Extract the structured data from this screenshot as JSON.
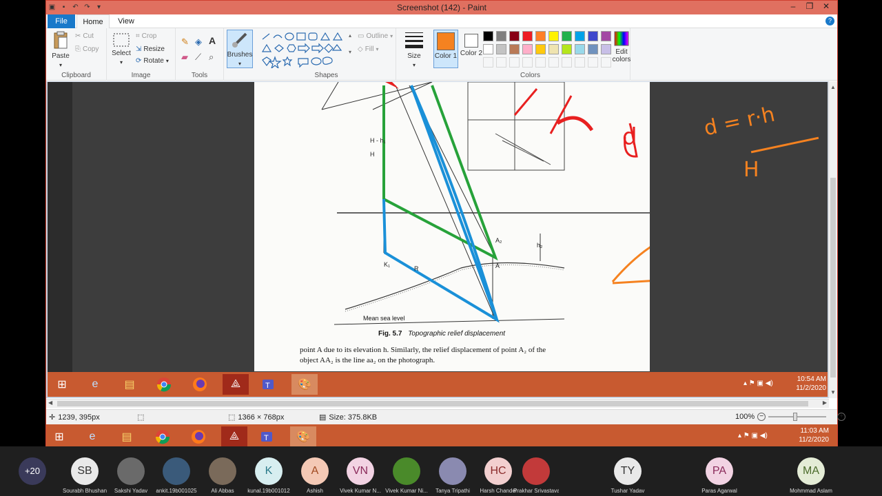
{
  "window": {
    "title": "Screenshot (142) - Paint"
  },
  "tabs": {
    "file": "File",
    "home": "Home",
    "view": "View"
  },
  "clipboard": {
    "paste": "Paste",
    "cut": "Cut",
    "copy": "Copy",
    "label": "Clipboard"
  },
  "image": {
    "select": "Select",
    "crop": "Crop",
    "resize": "Resize",
    "rotate": "Rotate",
    "label": "Image"
  },
  "tools": {
    "label": "Tools"
  },
  "brushes": {
    "label": "Brushes"
  },
  "shapes": {
    "outline": "Outline",
    "fill": "Fill",
    "label": "Shapes"
  },
  "size": {
    "label": "Size"
  },
  "colors": {
    "color1": "Color 1",
    "color2": "Color 2",
    "edit": "Edit colors",
    "label": "Colors",
    "color1_value": "#f58220",
    "color2_value": "#ffffff",
    "palette": [
      "#000000",
      "#7f7f7f",
      "#880015",
      "#ed1c24",
      "#ff7f27",
      "#fff200",
      "#22b14c",
      "#00a2e8",
      "#3f48cc",
      "#a349a4",
      "#ffffff",
      "#c3c3c3",
      "#b97a57",
      "#ffaec9",
      "#ffc90e",
      "#efe4b0",
      "#b5e61d",
      "#99d9ea",
      "#7092be",
      "#c8bfe7"
    ]
  },
  "document": {
    "figure_caption_num": "Fig. 5.7",
    "figure_caption": "Topographic relief displacement",
    "mean_sea_level": "Mean sea level",
    "body_line1": "point A due to its elevation h. Similarly, the relief displacement of point A₂ of the",
    "body_line2": "object AA₂ is the line aa₂ on the photograph.",
    "formula_lhs": "d = r·h",
    "formula_den": "H",
    "formula_d": "d",
    "labels": {
      "H": "H",
      "Hh1": "H - h₁",
      "A": "A",
      "A2": "A₂",
      "K1": "K₁",
      "R": "R",
      "h2": "h₂"
    }
  },
  "inner_taskbar": {
    "time": "10:54 AM",
    "date": "11/2/2020"
  },
  "status": {
    "cursor": "1239, 395px",
    "dimensions": "1366 × 768px",
    "filesize": "Size: 375.8KB",
    "zoom": "100%"
  },
  "outer_taskbar": {
    "time": "11:03 AM",
    "date": "11/2/2020"
  },
  "meeting": {
    "more": "+20",
    "participants": [
      {
        "initials": "SB",
        "name": "Sourabh Bhushan",
        "color": "#e9e9e9",
        "text": "#333"
      },
      {
        "initials": "",
        "name": "Sakshi Yadav",
        "color": "#6a6a6a",
        "text": "#fff"
      },
      {
        "initials": "",
        "name": "ankit.19b001025",
        "color": "#3a5a7a",
        "text": "#fff"
      },
      {
        "initials": "",
        "name": "Ali Abbas",
        "color": "#7a6a5a",
        "text": "#fff"
      },
      {
        "initials": "K",
        "name": "kunal.19b001012",
        "color": "#d7eef0",
        "text": "#2a7a8a"
      },
      {
        "initials": "A",
        "name": "Ashish",
        "color": "#f4c9b5",
        "text": "#a04a20"
      },
      {
        "initials": "VN",
        "name": "Vivek Kumar N...",
        "color": "#f2d3e3",
        "text": "#8a2a5a"
      },
      {
        "initials": "",
        "name": "Vivek Kumar Ni...",
        "color": "#4a8a2a",
        "text": "#fff"
      },
      {
        "initials": "",
        "name": "Tanya Tripathi",
        "color": "#8a8ab0",
        "text": "#fff"
      },
      {
        "initials": "HC",
        "name": "Harsh Chandel",
        "color": "#f2cfcf",
        "text": "#8a2a2a"
      },
      {
        "initials": "",
        "name": "Prakhar Srivastava",
        "color": "#c23a3a",
        "text": "#fff"
      },
      {
        "initials": "TY",
        "name": "Tushar Yadav",
        "color": "#e9e9e9",
        "text": "#333"
      },
      {
        "initials": "PA",
        "name": "Paras Agarwal",
        "color": "#f2d3e3",
        "text": "#8a2a5a"
      },
      {
        "initials": "MA",
        "name": "Mohmmad Aslam",
        "color": "#e4ecd6",
        "text": "#4a6a2a"
      }
    ]
  }
}
